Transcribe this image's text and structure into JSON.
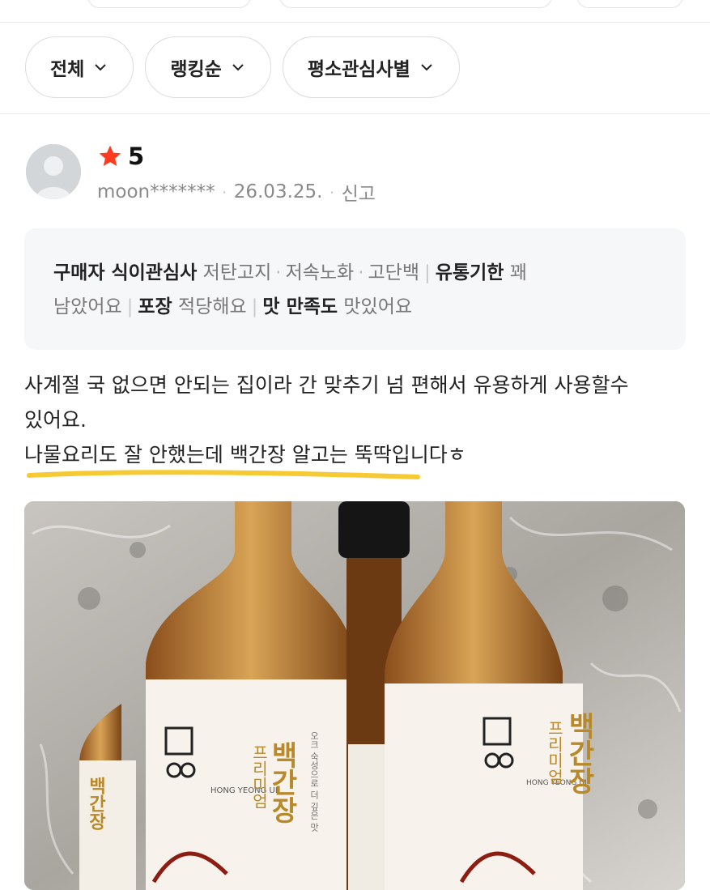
{
  "filters": [
    {
      "label": "전체"
    },
    {
      "label": "랭킹순"
    },
    {
      "label": "평소관심사별"
    }
  ],
  "review": {
    "rating": "5",
    "user": "moon*******",
    "date": "26.03.25.",
    "report": "신고",
    "attributes": {
      "buyer_label": "구매자 식이관심사",
      "tags": [
        "저탄고지",
        "저속노화",
        "고단백"
      ],
      "expiry_label": "유통기한",
      "expiry_value_1": "꽤",
      "expiry_value_2": "남았어요",
      "pack_label": "포장",
      "pack_value": "적당해요",
      "taste_label": "맛 만족도",
      "taste_value": "맛있어요"
    },
    "text_line1": "사계절 국 없으면 안되는 집이라 간 맞추기 넘 편해서 유용하게 사용할수",
    "text_line2": "있어요.",
    "text_line3": "나물요리도 잘 안했는데 백간장 알고는 뚝딱입니다ㅎ",
    "photo": {
      "brand": "홍영의",
      "brand_en": "HONG YEONG UI",
      "product_main": "백간장",
      "product_sub": "프리미엄",
      "product_desc": "오크 숙성으로 더 깊은 맛"
    }
  },
  "colors": {
    "accent_star": "#ff3b1f",
    "highlight": "#f7c933"
  }
}
